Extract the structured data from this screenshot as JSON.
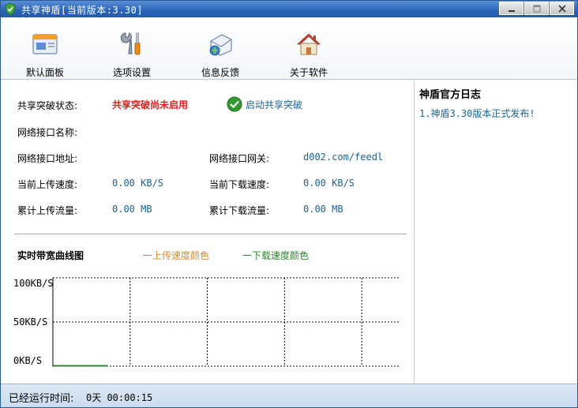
{
  "window": {
    "title": "共享神盾[当前版本:3.30]"
  },
  "toolbar": {
    "items": [
      {
        "label": "默认面板",
        "icon": "panel-icon"
      },
      {
        "label": "选项设置",
        "icon": "tools-icon"
      },
      {
        "label": "信息反馈",
        "icon": "feedback-icon"
      },
      {
        "label": "关于软件",
        "icon": "house-icon"
      }
    ]
  },
  "status": {
    "share_label": "共享突破状态:",
    "share_value": "共享突破尚未启用",
    "enable_label": "启动共享突破",
    "iface_name_label": "网络接口名称:",
    "iface_name_value": "",
    "iface_addr_label": "网络接口地址:",
    "iface_addr_value": "",
    "gateway_label": "网络接口网关:",
    "gateway_value": "d002.com/feedl",
    "up_speed_label": "当前上传速度:",
    "up_speed_value": "0.00 KB/S",
    "down_speed_label": "当前下载速度:",
    "down_speed_value": "0.00 KB/S",
    "up_total_label": "累计上传流量:",
    "up_total_value": "0.00 MB",
    "down_total_label": "累计下载流量:",
    "down_total_value": "0.00 MB"
  },
  "chart": {
    "title": "实时带宽曲线图",
    "legend_up": "一上传速度颜色",
    "legend_down": "一下载速度颜色",
    "up_color": "#e08a1e",
    "down_color": "#2a8a2a"
  },
  "chart_data": {
    "type": "line",
    "title": "实时带宽曲线图",
    "ylim": [
      0,
      100
    ],
    "y_ticks": [
      "100KB/S",
      "50KB/S",
      "0KB/S"
    ],
    "grid": true,
    "series": [
      {
        "name": "一上传速度颜色",
        "values": [
          0,
          0
        ]
      },
      {
        "name": "一下载速度颜色",
        "values": [
          0,
          0
        ]
      }
    ]
  },
  "news": {
    "title": "神盾官方日志",
    "items": [
      "1.神盾3.30版本正式发布!"
    ]
  },
  "footer": {
    "label": "已经运行时间:",
    "value": "0天 00:00:15"
  }
}
